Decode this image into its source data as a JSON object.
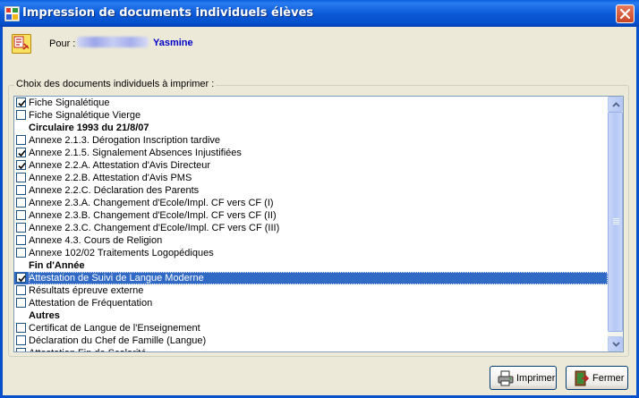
{
  "window": {
    "title": "Impression de documents individuels élèves"
  },
  "pupil": {
    "label": "Pour :",
    "name": "Yasmine"
  },
  "group": {
    "legend": "Choix des documents individuels à imprimer :"
  },
  "documents": [
    {
      "label": "Fiche Signalétique",
      "type": "item",
      "checked": true
    },
    {
      "label": "Fiche Signalétique Vierge",
      "type": "item",
      "checked": false
    },
    {
      "label": "Circulaire 1993 du 21/8/07",
      "type": "header"
    },
    {
      "label": "Annexe 2.1.3. Dérogation Inscription tardive",
      "type": "item",
      "checked": false
    },
    {
      "label": "Annexe 2.1.5. Signalement Absences Injustifiées",
      "type": "item",
      "checked": true
    },
    {
      "label": "Annexe 2.2.A. Attestation d'Avis Directeur",
      "type": "item",
      "checked": true
    },
    {
      "label": "Annexe 2.2.B. Attestation d'Avis PMS",
      "type": "item",
      "checked": false
    },
    {
      "label": "Annexe 2.2.C. Déclaration des Parents",
      "type": "item",
      "checked": false
    },
    {
      "label": "Annexe 2.3.A. Changement d'Ecole/Impl. CF vers CF (I)",
      "type": "item",
      "checked": false
    },
    {
      "label": "Annexe 2.3.B. Changement d'Ecole/Impl. CF vers CF (II)",
      "type": "item",
      "checked": false
    },
    {
      "label": "Annexe 2.3.C. Changement d'Ecole/Impl. CF vers CF (III)",
      "type": "item",
      "checked": false
    },
    {
      "label": "Annexe 4.3. Cours de Religion",
      "type": "item",
      "checked": false
    },
    {
      "label": "Annexe 102/02 Traitements Logopédiques",
      "type": "item",
      "checked": false
    },
    {
      "label": "Fin d'Année",
      "type": "header"
    },
    {
      "label": "Attestation de Suivi de Langue Moderne",
      "type": "item",
      "checked": true,
      "selected": true
    },
    {
      "label": "Résultats épreuve externe",
      "type": "item",
      "checked": false
    },
    {
      "label": "Attestation de Fréquentation",
      "type": "item",
      "checked": false
    },
    {
      "label": "Autres",
      "type": "header"
    },
    {
      "label": "Certificat de Langue de l'Enseignement",
      "type": "item",
      "checked": false
    },
    {
      "label": "Déclaration du Chef de Famille (Langue)",
      "type": "item",
      "checked": false
    },
    {
      "label": "Attestation Fin de Scolarité",
      "type": "item",
      "checked": false
    }
  ],
  "buttons": {
    "print": "Imprimer",
    "close": "Fermer"
  },
  "colors": {
    "titlebar": "#0A5FDD",
    "selection": "#316AC5",
    "pupil_name": "#0000C8",
    "dialog_bg": "#ECE9D8"
  }
}
